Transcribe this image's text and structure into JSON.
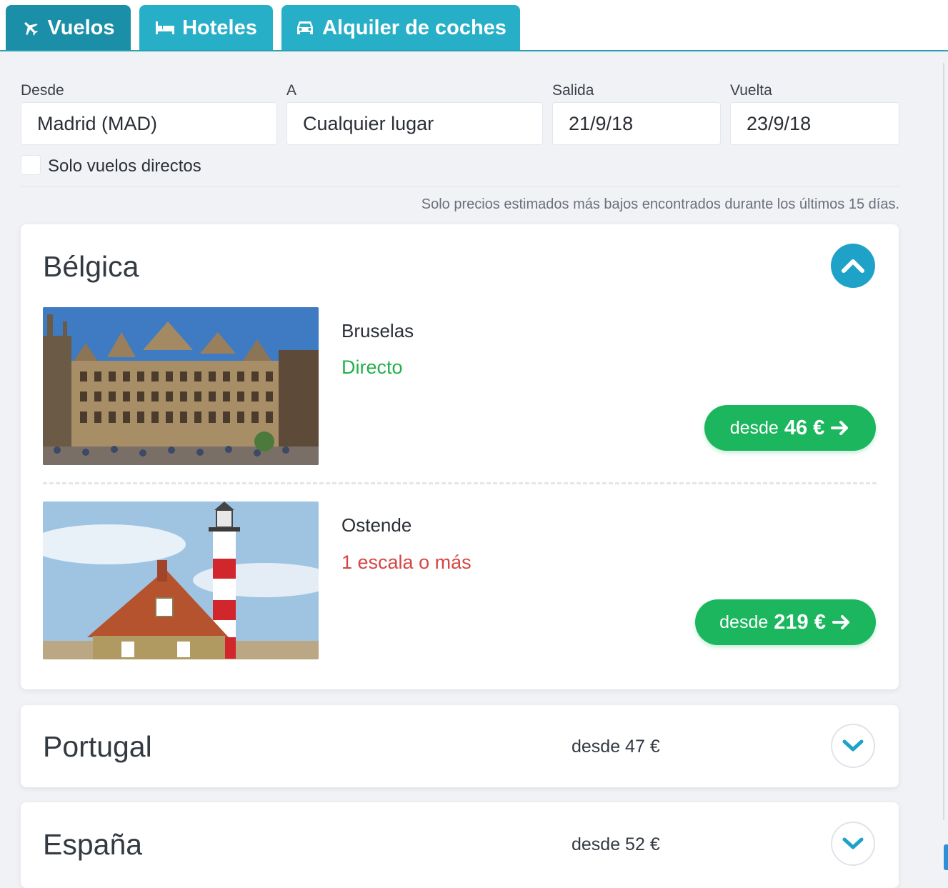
{
  "tabs": [
    {
      "label": "Vuelos",
      "icon": "plane-icon",
      "active": true
    },
    {
      "label": "Hoteles",
      "icon": "bed-icon",
      "active": false
    },
    {
      "label": "Alquiler de coches",
      "icon": "car-icon",
      "active": false
    }
  ],
  "search": {
    "from": {
      "label": "Desde",
      "value": "Madrid (MAD)"
    },
    "to": {
      "label": "A",
      "value": "Cualquier lugar"
    },
    "depart": {
      "label": "Salida",
      "value": "21/9/18"
    },
    "return": {
      "label": "Vuelta",
      "value": "23/9/18"
    },
    "direct_only": {
      "label": "Solo vuelos directos",
      "checked": false
    }
  },
  "note": "Solo precios estimados más bajos encontrados durante los últimos 15 días.",
  "countries": [
    {
      "name": "Bélgica",
      "expanded": true,
      "destinations": [
        {
          "city": "Bruselas",
          "status": "Directo",
          "status_color": "#22b04b",
          "price_prefix": "desde",
          "price": "46 €"
        },
        {
          "city": "Ostende",
          "status": "1 escala o más",
          "status_color": "#d64545",
          "price_prefix": "desde",
          "price": "219 €"
        }
      ]
    },
    {
      "name": "Portugal",
      "expanded": false,
      "price": "desde 47 €"
    },
    {
      "name": "España",
      "expanded": false,
      "price": "desde 52 €"
    }
  ],
  "colors": {
    "tab_active": "#1b8fa7",
    "tab_inactive": "#27afc8",
    "price_button": "#1bb65e",
    "toggle_open": "#1ea2c8"
  }
}
